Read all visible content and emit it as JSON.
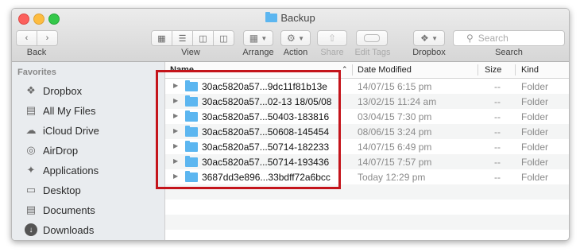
{
  "window": {
    "title": "Backup"
  },
  "toolbar": {
    "back_label": "Back",
    "view_label": "View",
    "arrange_label": "Arrange",
    "action_label": "Action",
    "share_label": "Share",
    "edit_tags_label": "Edit Tags",
    "dropbox_label": "Dropbox",
    "search_label": "Search",
    "search_placeholder": "Search"
  },
  "sidebar": {
    "heading": "Favorites",
    "items": [
      {
        "label": "Dropbox",
        "icon": "dropbox-icon"
      },
      {
        "label": "All My Files",
        "icon": "all-files-icon"
      },
      {
        "label": "iCloud Drive",
        "icon": "cloud-icon"
      },
      {
        "label": "AirDrop",
        "icon": "airdrop-icon"
      },
      {
        "label": "Applications",
        "icon": "applications-icon"
      },
      {
        "label": "Desktop",
        "icon": "desktop-icon"
      },
      {
        "label": "Documents",
        "icon": "documents-icon"
      },
      {
        "label": "Downloads",
        "icon": "downloads-icon"
      }
    ]
  },
  "table": {
    "columns": {
      "name": "Name",
      "date": "Date Modified",
      "size": "Size",
      "kind": "Kind"
    },
    "rows": [
      {
        "name": "30ac5820a57...9dc11f81b13e",
        "date": "14/07/15 6:15 pm",
        "size": "--",
        "kind": "Folder"
      },
      {
        "name": "30ac5820a57...02-13 18/05/08",
        "date": "13/02/15 11:24 am",
        "size": "--",
        "kind": "Folder"
      },
      {
        "name": "30ac5820a57...50403-183816",
        "date": "03/04/15 7:30 pm",
        "size": "--",
        "kind": "Folder"
      },
      {
        "name": "30ac5820a57...50608-145454",
        "date": "08/06/15 3:24 pm",
        "size": "--",
        "kind": "Folder"
      },
      {
        "name": "30ac5820a57...50714-182233",
        "date": "14/07/15 6:49 pm",
        "size": "--",
        "kind": "Folder"
      },
      {
        "name": "30ac5820a57...50714-193436",
        "date": "14/07/15 7:57 pm",
        "size": "--",
        "kind": "Folder"
      },
      {
        "name": "3687dd3e896...33bdff72a6bcc",
        "date": "Today 12:29 pm",
        "size": "--",
        "kind": "Folder"
      }
    ]
  },
  "colors": {
    "highlight": "#c4141b",
    "folder": "#5cb6f0"
  }
}
